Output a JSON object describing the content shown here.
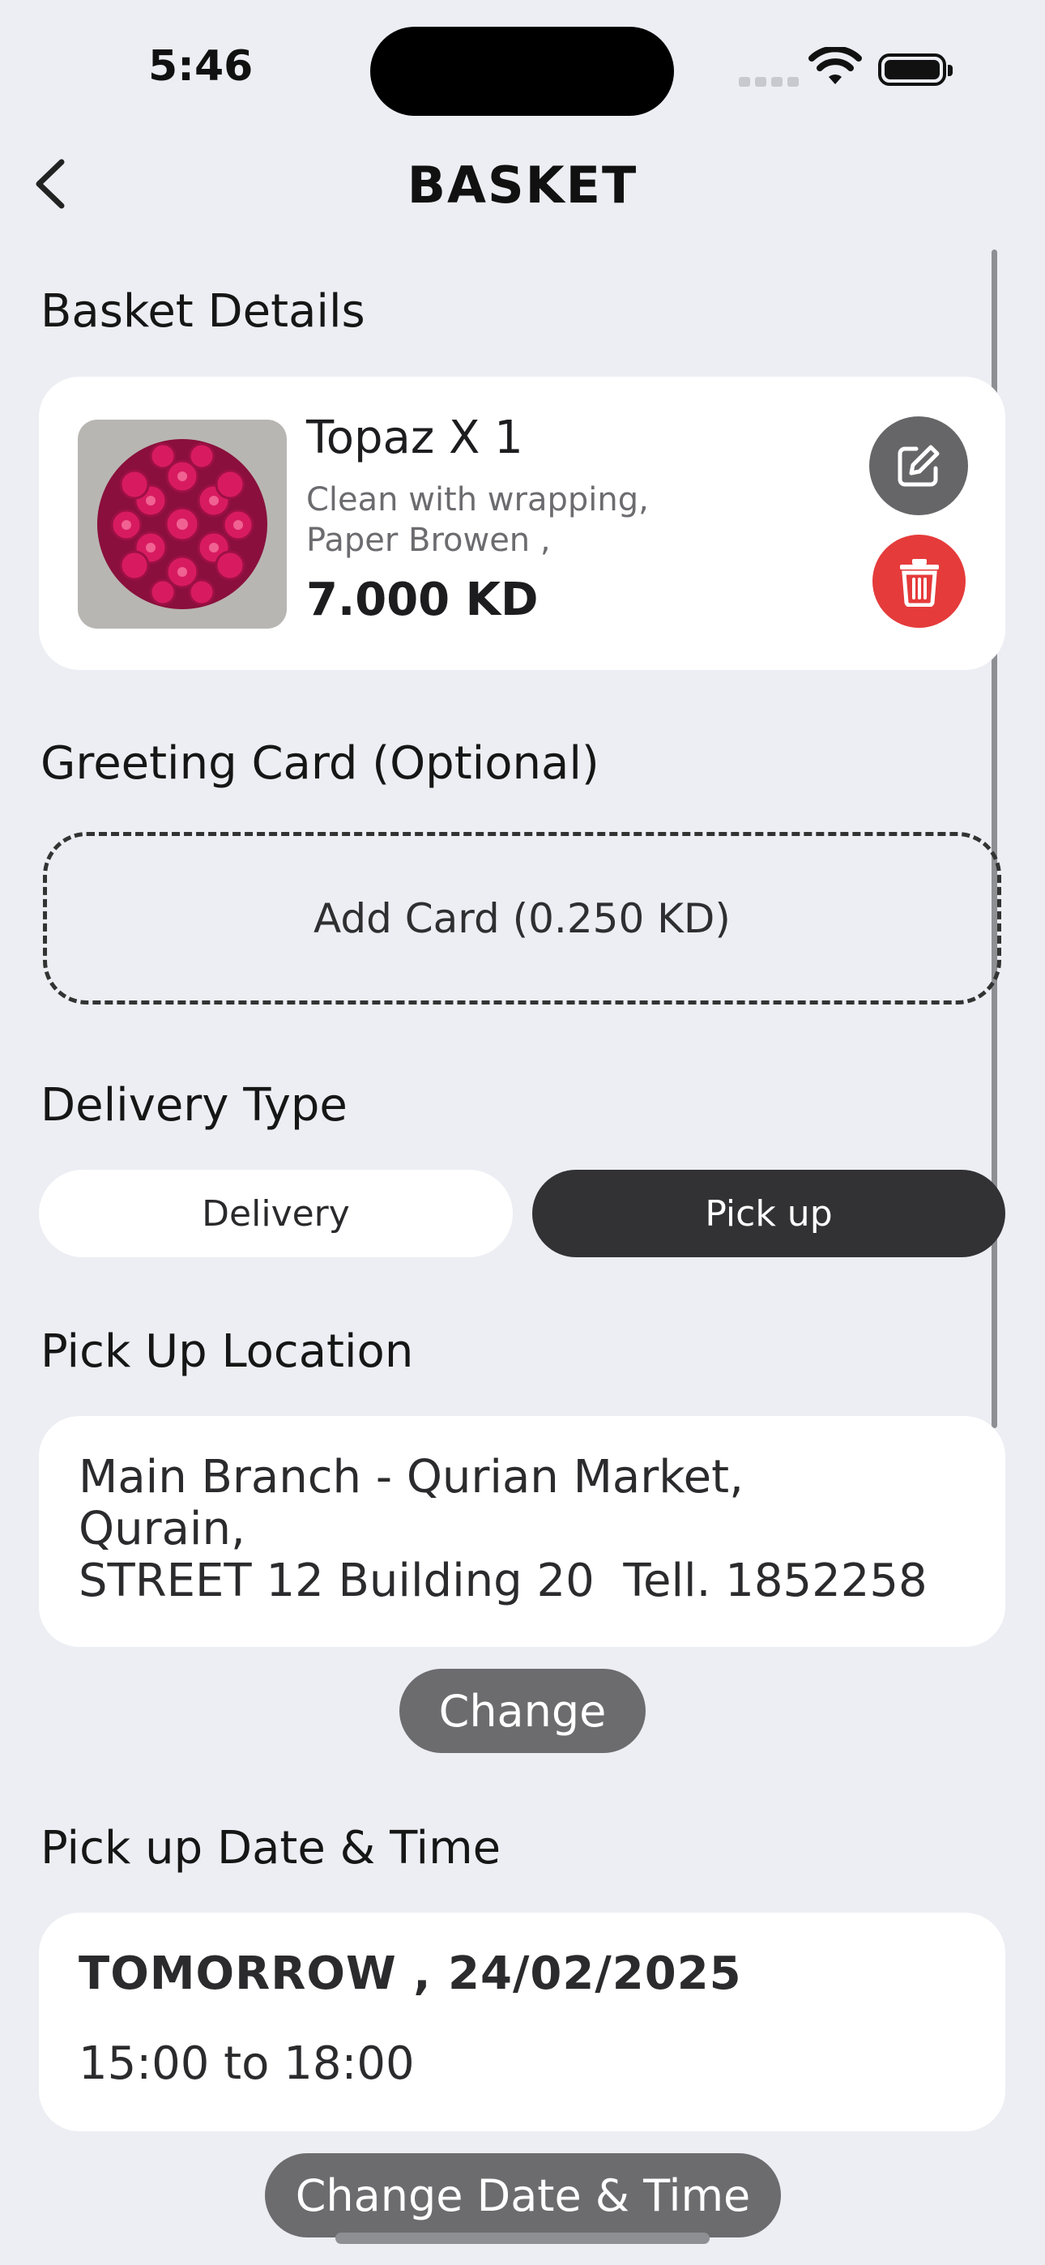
{
  "status_bar": {
    "time": "5:46"
  },
  "header": {
    "title": "BASKET"
  },
  "basket": {
    "section_title": "Basket Details",
    "item": {
      "name": "Topaz X 1",
      "desc_line1": "Clean with wrapping,",
      "desc_line2": "Paper Browen ,",
      "price": "7.000 KD"
    }
  },
  "greeting": {
    "section_title": "Greeting Card (Optional)",
    "add_label": "Add Card (0.250 KD)"
  },
  "delivery_type": {
    "section_title": "Delivery Type",
    "options": [
      "Delivery",
      "Pick up"
    ],
    "selected": "Pick up"
  },
  "pickup_location": {
    "section_title": "Pick Up Location",
    "line1": "Main Branch - Qurian Market,",
    "line2": "Qurain,",
    "line3": "STREET 12 Building 20  Tell. 1852258",
    "change_label": "Change"
  },
  "pickup_date": {
    "section_title": "Pick up Date & Time",
    "date": "TOMORROW , 24/02/2025",
    "time": "15:00 to 18:00",
    "change_label": "Change Date & Time"
  },
  "colors": {
    "background": "#eceef3",
    "selected_segment": "#323234",
    "delete": "#e53b3b",
    "edit": "#666668"
  },
  "icons": {
    "back": "chevron-left-icon",
    "edit": "edit-icon",
    "delete": "trash-icon"
  }
}
